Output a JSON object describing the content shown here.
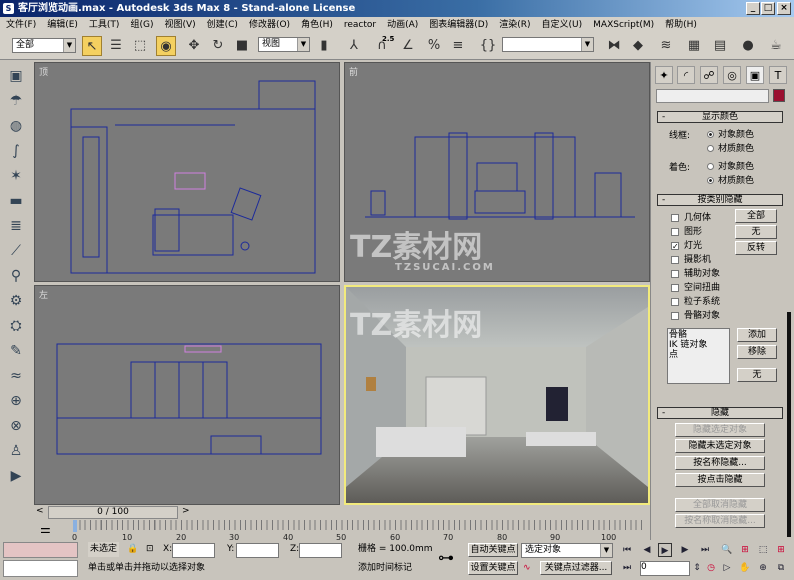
{
  "window": {
    "title": "客厅浏览动画.max - Autodesk 3ds Max 8  - Stand-alone License",
    "min": "_",
    "max": "□",
    "close": "×"
  },
  "menu": [
    "文件(F)",
    "编辑(E)",
    "工具(T)",
    "组(G)",
    "视图(V)",
    "创建(C)",
    "修改器(O)",
    "角色(H)",
    "reactor",
    "动画(A)",
    "图表编辑器(D)",
    "渲染(R)",
    "自定义(U)",
    "MAXScript(M)",
    "帮助(H)"
  ],
  "toolbar": {
    "selection_filter": "全部",
    "ref_coord": "视图",
    "snap_label": "2.5",
    "named_selection": ""
  },
  "viewports": {
    "top": "顶",
    "front": "前",
    "left": "左"
  },
  "watermark": {
    "main": "TZ素材网",
    "sub": "TZSUCAI.COM"
  },
  "time_slider": {
    "label": "0 / 100",
    "current": 0,
    "max": 100
  },
  "trackbar": {
    "ticks": [
      "0",
      "10",
      "20",
      "30",
      "40",
      "50",
      "60",
      "70",
      "80",
      "90",
      "100"
    ]
  },
  "panel": {
    "color_swatch": "#9b1030",
    "display_color": {
      "title": "显示颜色",
      "wireframe_label": "线框:",
      "shaded_label": "着色:",
      "object_color": "对象颜色",
      "material_color": "材质颜色",
      "wireframe_selected": "object",
      "shaded_selected": "material"
    },
    "hide_by_category": {
      "title": "按类别隐藏",
      "items": [
        {
          "label": "几何体",
          "checked": false
        },
        {
          "label": "图形",
          "checked": false
        },
        {
          "label": "灯光",
          "checked": true
        },
        {
          "label": "摄影机",
          "checked": false
        },
        {
          "label": "辅助对象",
          "checked": false
        },
        {
          "label": "空间扭曲",
          "checked": false
        },
        {
          "label": "粒子系统",
          "checked": false
        },
        {
          "label": "骨骼对象",
          "checked": false
        }
      ],
      "all": "全部",
      "none": "无",
      "invert": "反转",
      "list": [
        "骨骼",
        "IK 链对象",
        "点"
      ],
      "add": "添加",
      "remove": "移除",
      "none2": "无"
    },
    "hide": {
      "title": "隐藏",
      "buttons": [
        {
          "label": "隐藏选定对象",
          "enabled": false
        },
        {
          "label": "隐藏未选定对象",
          "enabled": true
        },
        {
          "label": "按名称隐藏...",
          "enabled": true
        },
        {
          "label": "按点击隐藏",
          "enabled": true
        },
        {
          "label": "全部取消隐藏",
          "enabled": false
        },
        {
          "label": "按名称取消隐藏...",
          "enabled": false
        }
      ]
    }
  },
  "status": {
    "selection": "未选定",
    "x_label": "X:",
    "y_label": "Y:",
    "z_label": "Z:",
    "x": "",
    "y": "",
    "z": "",
    "grid": "栅格 = 100.0mm",
    "prompt": "单击或单击并拖动以选择对象",
    "add_time_tag": "添加时间标记",
    "auto_key": "自动关键点",
    "set_key": "设置关键点",
    "key_mode": "选定对象",
    "key_filters": "关键点过滤器...",
    "frame": "0"
  }
}
